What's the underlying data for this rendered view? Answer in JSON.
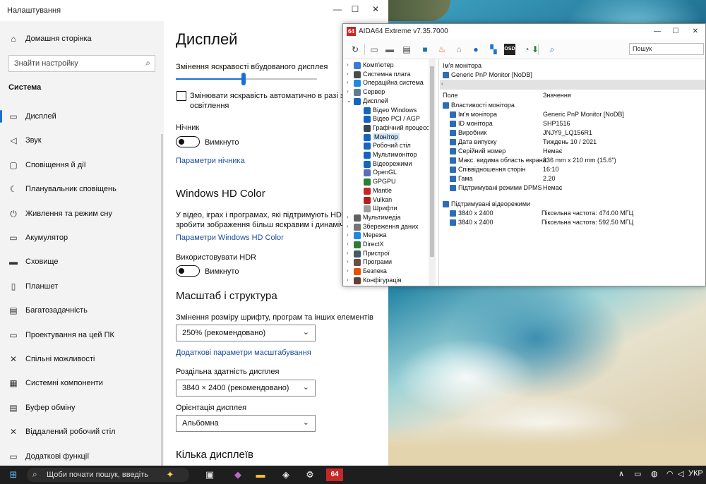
{
  "settings": {
    "window_title": "Налаштування",
    "nav": {
      "home": "Домашня сторінка",
      "search_placeholder": "Знайти настройку",
      "section": "Система",
      "items": [
        {
          "label": "Дисплей",
          "icon": "monitor-icon"
        },
        {
          "label": "Звук",
          "icon": "speaker-icon"
        },
        {
          "label": "Сповіщення й дії",
          "icon": "notification-icon"
        },
        {
          "label": "Планувальник сповіщень",
          "icon": "moon-icon"
        },
        {
          "label": "Живлення та режим сну",
          "icon": "power-icon"
        },
        {
          "label": "Акумулятор",
          "icon": "battery-icon"
        },
        {
          "label": "Сховище",
          "icon": "storage-icon"
        },
        {
          "label": "Планшет",
          "icon": "tablet-icon"
        },
        {
          "label": "Багатозадачність",
          "icon": "multitask-icon"
        },
        {
          "label": "Проектування на цей ПК",
          "icon": "project-icon"
        },
        {
          "label": "Спільні можливості",
          "icon": "shared-icon"
        },
        {
          "label": "Системні компоненти",
          "icon": "components-icon"
        },
        {
          "label": "Буфер обміну",
          "icon": "clipboard-icon"
        },
        {
          "label": "Віддалений робочий стіл",
          "icon": "remote-desktop-icon"
        },
        {
          "label": "Додаткові функції",
          "icon": "features-icon"
        }
      ]
    },
    "content": {
      "title": "Дисплей",
      "brightness_label": "Змінення яскравості вбудованого дисплея",
      "brightness_level_percent": 48,
      "auto_brightness_line1": "Змінювати яскравість автоматично в разі зміне",
      "auto_brightness_line2": "освітлення",
      "night_light_label": "Нічник",
      "night_light_state": "Вимкнуто",
      "night_light_link": "Параметри нічника",
      "hd_color_heading": "Windows HD Color",
      "hd_color_desc1": "У відео, іграх і програмах, які підтримують HDR, мо",
      "hd_color_desc2": "зробити зображення більш яскравим і динамічним",
      "hd_color_link": "Параметри Windows HD Color",
      "hdr_label": "Використовувати HDR",
      "hdr_state": "Вимкнуто",
      "scale_heading": "Масштаб і структура",
      "scale_label": "Змінення розміру шрифту, програм та інших елементів",
      "scale_value": "250% (рекомендовано)",
      "scale_link": "Додаткові параметри масштабування",
      "resolution_label": "Роздільна здатність дисплея",
      "resolution_value": "3840 × 2400 (рекомендовано)",
      "orientation_label": "Орієнтація дисплея",
      "orientation_value": "Альбомна",
      "multi_display_heading": "Кілька дисплеїв"
    }
  },
  "aida": {
    "logo": "64",
    "window_title": "AIDA64 Extreme v7.35.7000",
    "search_placeholder": "Пошук",
    "tree": [
      {
        "label": "Комп'ютер",
        "level": 0,
        "expander": "›",
        "color": "#3a7bd5"
      },
      {
        "label": "Системна плата",
        "level": 0,
        "expander": "›",
        "color": "#4a4a4a"
      },
      {
        "label": "Операційна система",
        "level": 0,
        "expander": "›",
        "color": "#1e88e5"
      },
      {
        "label": "Сервер",
        "level": 0,
        "expander": "›",
        "color": "#607d8b"
      },
      {
        "label": "Дисплей",
        "level": 0,
        "expander": "⌄",
        "color": "#1565c0"
      },
      {
        "label": "Відео Windows",
        "level": 1,
        "expander": "",
        "color": "#1565c0"
      },
      {
        "label": "Відео PCI / AGP",
        "level": 1,
        "expander": "",
        "color": "#1565c0"
      },
      {
        "label": "Графічний процесор",
        "level": 1,
        "expander": "",
        "color": "#37474f"
      },
      {
        "label": "Монітор",
        "level": 1,
        "expander": "",
        "color": "#1565c0",
        "selected": true
      },
      {
        "label": "Робочий стіл",
        "level": 1,
        "expander": "",
        "color": "#1565c0"
      },
      {
        "label": "Мультимонітор",
        "level": 1,
        "expander": "",
        "color": "#1565c0"
      },
      {
        "label": "Відеорежими",
        "level": 1,
        "expander": "",
        "color": "#1565c0"
      },
      {
        "label": "OpenGL",
        "level": 1,
        "expander": "",
        "color": "#5c6bc0"
      },
      {
        "label": "GPGPU",
        "level": 1,
        "expander": "",
        "color": "#2e7d32"
      },
      {
        "label": "Mantle",
        "level": 1,
        "expander": "",
        "color": "#c62828"
      },
      {
        "label": "Vulkan",
        "level": 1,
        "expander": "",
        "color": "#b71c1c"
      },
      {
        "label": "Шрифти",
        "level": 1,
        "expander": "",
        "color": "#9e9e9e"
      },
      {
        "label": "Мультимедіа",
        "level": 0,
        "expander": "›",
        "color": "#616161"
      },
      {
        "label": "Збереження даних",
        "level": 0,
        "expander": "›",
        "color": "#757575"
      },
      {
        "label": "Мережа",
        "level": 0,
        "expander": "›",
        "color": "#1e88e5"
      },
      {
        "label": "DirectX",
        "level": 0,
        "expander": "›",
        "color": "#2e7d32"
      },
      {
        "label": "Пристрої",
        "level": 0,
        "expander": "›",
        "color": "#455a64"
      },
      {
        "label": "Програми",
        "level": 0,
        "expander": "›",
        "color": "#6d4c41"
      },
      {
        "label": "Безпека",
        "level": 0,
        "expander": "›",
        "color": "#e65100"
      },
      {
        "label": "Конфігурація",
        "level": 0,
        "expander": "›",
        "color": "#5d4037"
      }
    ],
    "detail": {
      "monitor_name_header": "Ім'я монітора",
      "monitor_item": "Generic PnP Monitor [NoDB]",
      "col_field": "Поле",
      "col_value": "Значення",
      "group1": "Властивості монітора",
      "rows": [
        {
          "field": "Ім'я монітора",
          "value": "Generic PnP Monitor [NoDB]"
        },
        {
          "field": "ID монітора",
          "value": "SHP1516"
        },
        {
          "field": "Виробник",
          "value": "JNJY9_LQ156R1"
        },
        {
          "field": "Дата випуску",
          "value": "Тиждень 10 / 2021"
        },
        {
          "field": "Серійний номер",
          "value": "Немає"
        },
        {
          "field": "Макс. видима область екрана",
          "value": "336 mm x 210 mm (15.6\")"
        },
        {
          "field": "Співвідношення сторін",
          "value": "16:10"
        },
        {
          "field": "Гама",
          "value": "2.20"
        },
        {
          "field": "Підтримувані режими DPMS",
          "value": "Немає"
        }
      ],
      "group2": "Підтримувані відеорежими",
      "modes": [
        {
          "field": "3840 x 2400",
          "value": "Піксельна частота: 474.00 МГЦ"
        },
        {
          "field": "3840 x 2400",
          "value": "Піксельна частота: 592.50 МГЦ"
        }
      ]
    }
  },
  "taskbar": {
    "search_placeholder": "Щоби почати пошук, введіть",
    "tray_language": "УКР"
  },
  "colors": {
    "accent": "#1a6fd6",
    "link": "#1b4f9c",
    "aida_logo": "#c62828",
    "taskbar": "#1e1e1e"
  }
}
